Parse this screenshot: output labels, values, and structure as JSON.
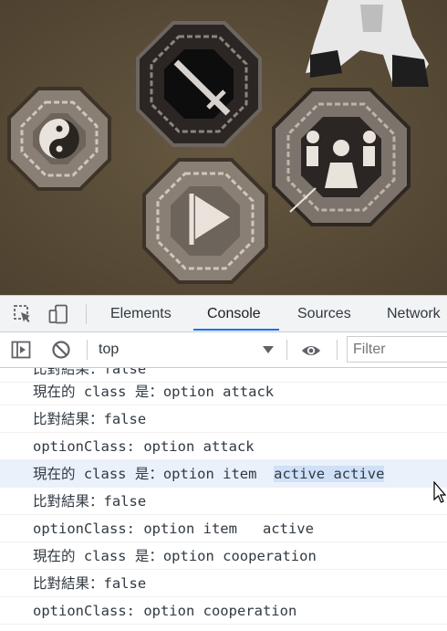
{
  "devtools": {
    "tabs": [
      {
        "label": "Elements"
      },
      {
        "label": "Console"
      },
      {
        "label": "Sources"
      },
      {
        "label": "Network"
      }
    ],
    "active_tab": "Console",
    "context_select": "top",
    "filter_placeholder": "Filter"
  },
  "console_lines": [
    {
      "prefix": "比對結果：false",
      "selected": ""
    },
    {
      "prefix": "現在的 class 是：option attack",
      "selected": ""
    },
    {
      "prefix": "比對結果：false",
      "selected": ""
    },
    {
      "prefix": "optionClass: option attack",
      "selected": ""
    },
    {
      "prefix": "現在的 class 是：option item  ",
      "selected": "active active"
    },
    {
      "prefix": "比對結果：false",
      "selected": ""
    },
    {
      "prefix": "optionClass: option item   active",
      "selected": ""
    },
    {
      "prefix": "現在的 class 是：option cooperation",
      "selected": ""
    },
    {
      "prefix": "比對結果：false",
      "selected": ""
    },
    {
      "prefix": "optionClass: option cooperation",
      "selected": ""
    }
  ],
  "colors": {
    "accent": "#1a73e8",
    "game_background": "#5b4e3a",
    "highlight_row": "#eaf1fb",
    "selection": "#cfe0f7"
  },
  "game_icons": [
    "yin-yang-icon",
    "sword-icon",
    "flag-icon",
    "cooperation-icon"
  ]
}
